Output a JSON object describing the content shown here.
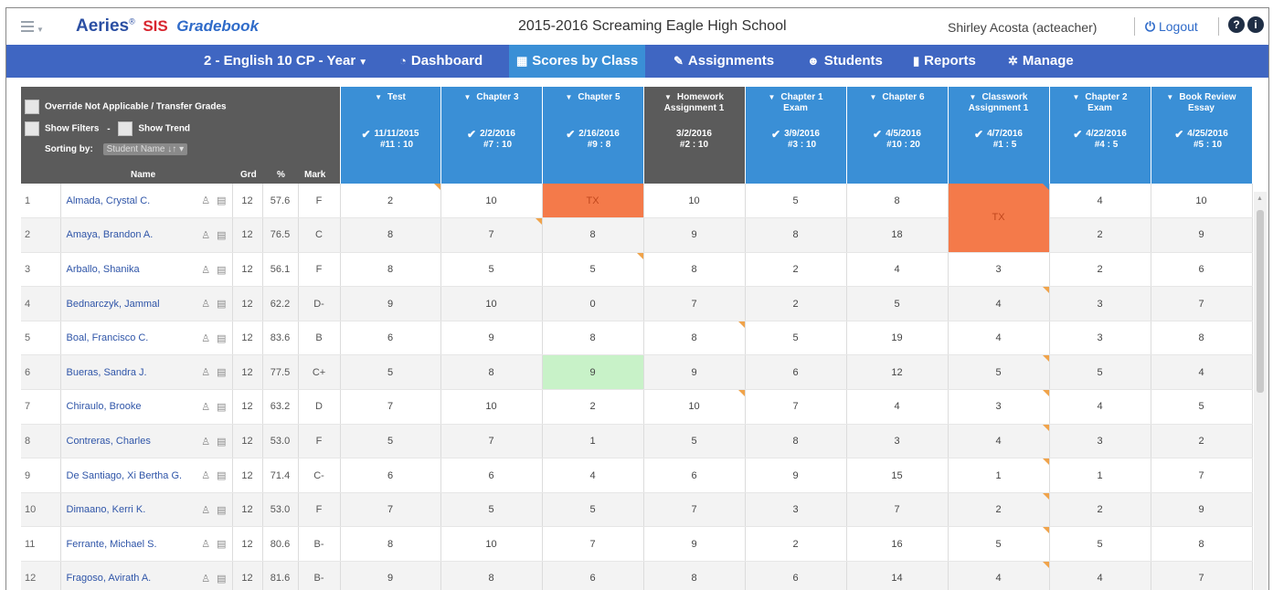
{
  "header": {
    "brand_aeries": "Aeries",
    "brand_reg": "®",
    "brand_sis": "SIS",
    "brand_gradebook": "Gradebook",
    "school": "2015-2016 Screaming Eagle High School",
    "user": "Shirley Acosta (acteacher)",
    "logout": "Logout"
  },
  "nav": {
    "class_selector": "2 - English 10 CP - Year",
    "items": [
      {
        "label": "Dashboard",
        "icon": "dashboard-icon"
      },
      {
        "label": "Scores by Class",
        "icon": "grid-icon"
      },
      {
        "label": "Assignments",
        "icon": "edit-icon"
      },
      {
        "label": "Students",
        "icon": "users-icon"
      },
      {
        "label": "Reports",
        "icon": "document-icon"
      },
      {
        "label": "Manage",
        "icon": "gear-icon"
      }
    ]
  },
  "controls": {
    "override": "Override Not Applicable / Transfer Grades",
    "show_filters": "Show Filters",
    "dash": "-",
    "show_trend": "Show Trend",
    "sorting_by": "Sorting by:",
    "sort_value": "Student Name ↓↑"
  },
  "columns": {
    "name": "Name",
    "grd": "Grd",
    "pct": "%",
    "mark": "Mark"
  },
  "assignments": [
    {
      "title": "Test",
      "date": "11/11/2015",
      "num": "#11 : 10",
      "checked": true
    },
    {
      "title": "Chapter 3",
      "date": "2/2/2016",
      "num": "#7 : 10",
      "checked": true
    },
    {
      "title": "Chapter 5",
      "date": "2/16/2016",
      "num": "#9 : 8",
      "checked": true
    },
    {
      "title": "Homework Assignment 1",
      "date": "3/2/2016",
      "num": "#2 : 10",
      "checked": false
    },
    {
      "title": "Chapter 1 Exam",
      "date": "3/9/2016",
      "num": "#3 : 10",
      "checked": true
    },
    {
      "title": "Chapter 6",
      "date": "4/5/2016",
      "num": "#10 : 20",
      "checked": true
    },
    {
      "title": "Classwork Assignment 1",
      "date": "4/7/2016",
      "num": "#1 : 5",
      "checked": true
    },
    {
      "title": "Chapter 2 Exam",
      "date": "4/22/2016",
      "num": "#4 : 5",
      "checked": true
    },
    {
      "title": "Book Review Essay",
      "date": "4/25/2016",
      "num": "#5 : 10",
      "checked": true
    }
  ],
  "students": [
    {
      "n": "1",
      "name": "Almada, Crystal C.",
      "grd": "12",
      "pct": "57.6",
      "mark": "F",
      "scores": [
        "2",
        "10",
        "TX",
        "10",
        "5",
        "8",
        "TX",
        "4",
        "10"
      ]
    },
    {
      "n": "2",
      "name": "Amaya, Brandon A.",
      "grd": "12",
      "pct": "76.5",
      "mark": "C",
      "scores": [
        "8",
        "7",
        "8",
        "9",
        "8",
        "18",
        "",
        "2",
        "9"
      ]
    },
    {
      "n": "3",
      "name": "Arballo, Shanika",
      "grd": "12",
      "pct": "56.1",
      "mark": "F",
      "scores": [
        "8",
        "5",
        "5",
        "8",
        "2",
        "4",
        "3",
        "2",
        "6"
      ]
    },
    {
      "n": "4",
      "name": "Bednarczyk, Jammal",
      "grd": "12",
      "pct": "62.2",
      "mark": "D-",
      "scores": [
        "9",
        "10",
        "0",
        "7",
        "2",
        "5",
        "4",
        "3",
        "7"
      ]
    },
    {
      "n": "5",
      "name": "Boal, Francisco C.",
      "grd": "12",
      "pct": "83.6",
      "mark": "B",
      "scores": [
        "6",
        "9",
        "8",
        "8",
        "5",
        "19",
        "4",
        "3",
        "8"
      ]
    },
    {
      "n": "6",
      "name": "Bueras, Sandra J.",
      "grd": "12",
      "pct": "77.5",
      "mark": "C+",
      "scores": [
        "5",
        "8",
        "9",
        "9",
        "6",
        "12",
        "5",
        "5",
        "4"
      ]
    },
    {
      "n": "7",
      "name": "Chiraulo, Brooke",
      "grd": "12",
      "pct": "63.2",
      "mark": "D",
      "scores": [
        "7",
        "10",
        "2",
        "10",
        "7",
        "4",
        "3",
        "4",
        "5"
      ]
    },
    {
      "n": "8",
      "name": "Contreras, Charles",
      "grd": "12",
      "pct": "53.0",
      "mark": "F",
      "scores": [
        "5",
        "7",
        "1",
        "5",
        "8",
        "3",
        "4",
        "3",
        "2"
      ]
    },
    {
      "n": "9",
      "name": "De Santiago, Xi Bertha G.",
      "grd": "12",
      "pct": "71.4",
      "mark": "C-",
      "scores": [
        "6",
        "6",
        "4",
        "6",
        "9",
        "15",
        "1",
        "1",
        "7"
      ]
    },
    {
      "n": "10",
      "name": "Dimaano, Kerri K.",
      "grd": "12",
      "pct": "53.0",
      "mark": "F",
      "scores": [
        "7",
        "5",
        "5",
        "7",
        "3",
        "7",
        "2",
        "2",
        "9"
      ]
    },
    {
      "n": "11",
      "name": "Ferrante, Michael S.",
      "grd": "12",
      "pct": "80.6",
      "mark": "B-",
      "scores": [
        "8",
        "10",
        "7",
        "9",
        "2",
        "16",
        "5",
        "5",
        "8"
      ]
    },
    {
      "n": "12",
      "name": "Fragoso, Avirath A.",
      "grd": "12",
      "pct": "81.6",
      "mark": "B-",
      "scores": [
        "9",
        "8",
        "6",
        "8",
        "6",
        "14",
        "4",
        "4",
        "7"
      ]
    }
  ],
  "colors": {
    "nav_bg": "#3f66c2",
    "active_tab": "#3a8fd6",
    "tx_cell": "#f47a4a",
    "highlight_cell": "#c8f2c8",
    "comment_flag": "#f0a34a"
  }
}
